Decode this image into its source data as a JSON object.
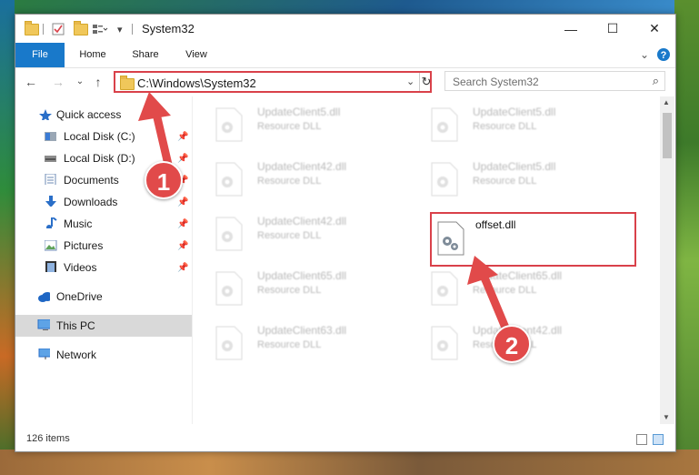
{
  "window": {
    "title": "System32"
  },
  "ribbon": {
    "tabs": [
      "File",
      "Home",
      "Share",
      "View"
    ]
  },
  "address": {
    "path": "C:\\Windows\\System32"
  },
  "search": {
    "placeholder": "Search System32"
  },
  "sidebar": {
    "items": [
      {
        "label": "Quick access",
        "icon": "star-icon",
        "pinned": false
      },
      {
        "label": "Local Disk (C:)",
        "icon": "drive-icon",
        "pinned": true
      },
      {
        "label": "Local Disk (D:)",
        "icon": "drive-icon",
        "pinned": true
      },
      {
        "label": "Documents",
        "icon": "documents-icon",
        "pinned": true
      },
      {
        "label": "Downloads",
        "icon": "download-icon",
        "pinned": true
      },
      {
        "label": "Music",
        "icon": "music-icon",
        "pinned": true
      },
      {
        "label": "Pictures",
        "icon": "pictures-icon",
        "pinned": true
      },
      {
        "label": "Videos",
        "icon": "video-icon",
        "pinned": true
      },
      {
        "label": "OneDrive",
        "icon": "cloud-icon",
        "pinned": false
      },
      {
        "label": "This PC",
        "icon": "computer-icon",
        "pinned": false,
        "selected": true
      },
      {
        "label": "Network",
        "icon": "network-icon",
        "pinned": false
      }
    ]
  },
  "files": [
    {
      "name": "UpdateClient5.dll",
      "type": "Resource DLL"
    },
    {
      "name": "UpdateClient5.dll",
      "type": "Resource DLL"
    },
    {
      "name": "UpdateClient42.dll",
      "type": "Resource DLL"
    },
    {
      "name": "UpdateClient5.dll",
      "type": "Resource DLL"
    },
    {
      "name": "UpdateClient42.dll",
      "type": "Resource DLL"
    },
    {
      "name": "offset.dll",
      "type": ""
    },
    {
      "name": "UpdateClient65.dll",
      "type": "Resource DLL"
    },
    {
      "name": "UpdateClient65.dll",
      "type": "Resource DLL"
    },
    {
      "name": "UpdateClient63.dll",
      "type": "Resource DLL"
    },
    {
      "name": "UpdateClient42.dll",
      "type": "Resource DLL"
    }
  ],
  "status": {
    "item_count": "126 items"
  },
  "callouts": {
    "first": "1",
    "second": "2"
  },
  "colors": {
    "accent": "#1979ca",
    "highlight": "#d9414a",
    "callout": "#e14a4a",
    "selected_bg": "#d9d9d9"
  }
}
